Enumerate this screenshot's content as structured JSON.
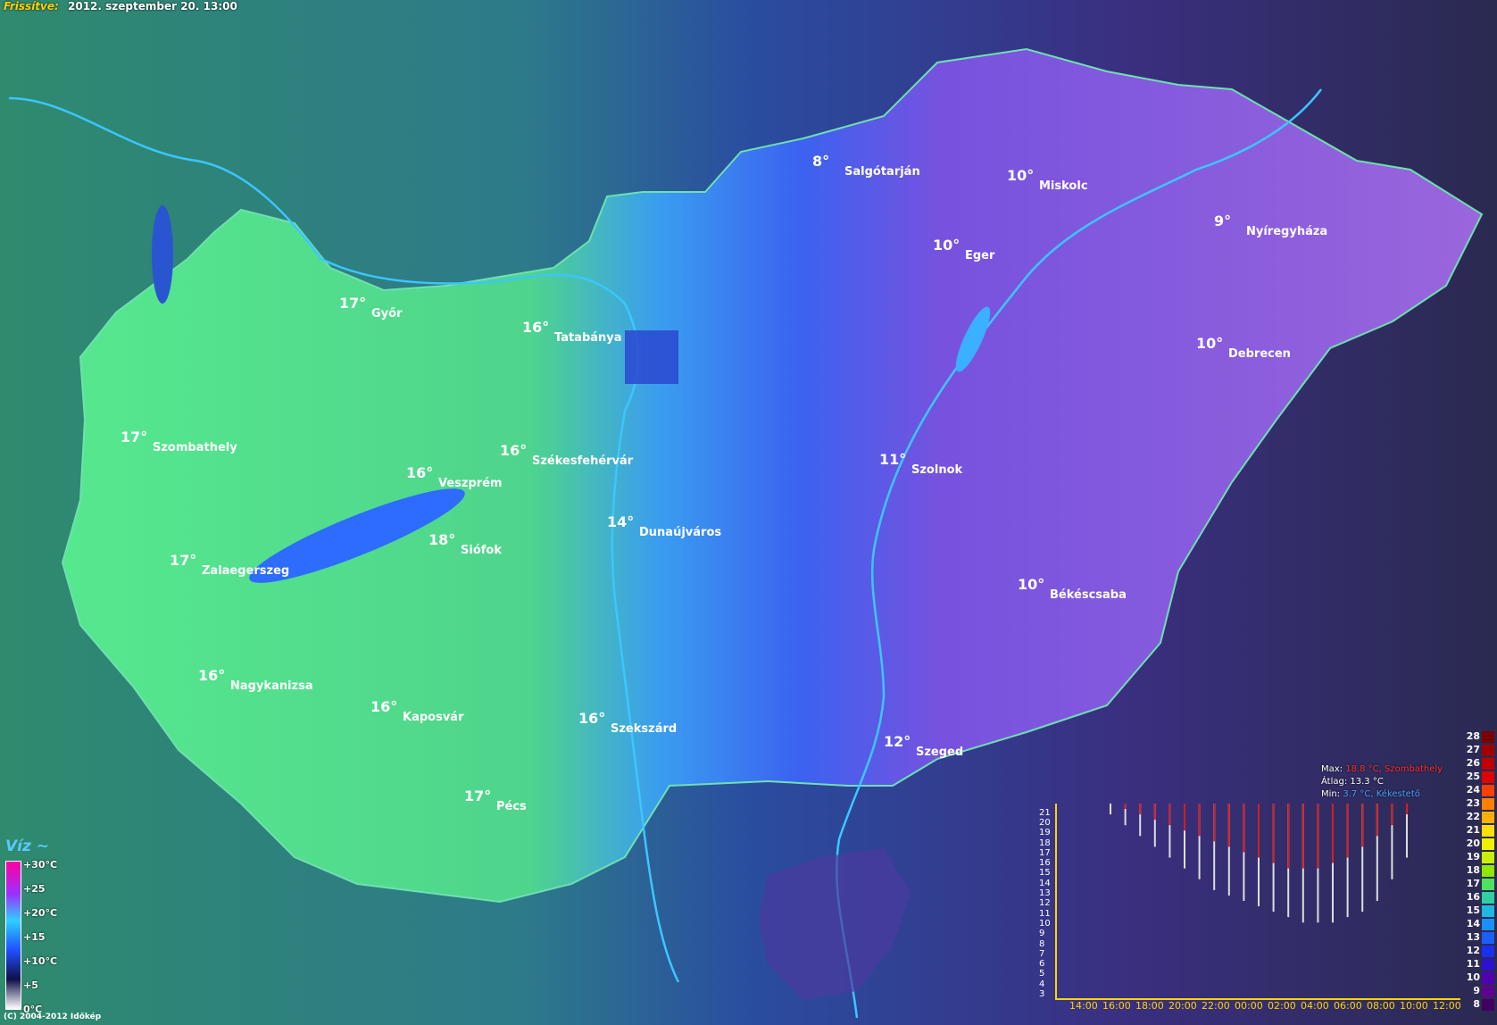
{
  "header": {
    "label": "Frissítve:",
    "timestamp": "2012. szeptember 20. 13:00"
  },
  "copyright": "(C) 2004-2012 Időkép",
  "cities": [
    {
      "name": "Győr",
      "temp": "17°"
    },
    {
      "name": "Tatabánya",
      "temp": "16°"
    },
    {
      "name": "Szombathely",
      "temp": "17°"
    },
    {
      "name": "Veszprém",
      "temp": "16°"
    },
    {
      "name": "Székesfehérvár",
      "temp": "16°"
    },
    {
      "name": "Siófok",
      "temp": "18°"
    },
    {
      "name": "Zalaegerszeg",
      "temp": "17°"
    },
    {
      "name": "Dunaújváros",
      "temp": "14°"
    },
    {
      "name": "Nagykanizsa",
      "temp": "16°"
    },
    {
      "name": "Kaposvár",
      "temp": "16°"
    },
    {
      "name": "Szekszárd",
      "temp": "16°"
    },
    {
      "name": "Pécs",
      "temp": "17°"
    },
    {
      "name": "Szeged",
      "temp": "12°"
    },
    {
      "name": "Salgótarján",
      "temp": "8°"
    },
    {
      "name": "Miskolc",
      "temp": "10°"
    },
    {
      "name": "Eger",
      "temp": "10°"
    },
    {
      "name": "Nyíregyháza",
      "temp": "9°"
    },
    {
      "name": "Debrecen",
      "temp": "10°"
    },
    {
      "name": "Szolnok",
      "temp": "11°"
    },
    {
      "name": "Békéscsaba",
      "temp": "10°"
    }
  ],
  "legend": {
    "title": "Víz ~",
    "labels": [
      "+30°C",
      "+25",
      "+20°C",
      "+15",
      "+10°C",
      "+5",
      "0°C"
    ]
  },
  "stats": {
    "max_label": "Max:",
    "max_value": "18.8 °C, Szombathely",
    "avg_label": "Átlag:",
    "avg_value": "13.3 °C",
    "min_label": "Min:",
    "min_value": "3.7 °C, Kékestető"
  },
  "temp_scale": [
    28,
    27,
    26,
    25,
    24,
    23,
    22,
    21,
    20,
    19,
    18,
    17,
    16,
    15,
    14,
    13,
    12,
    11,
    10,
    9,
    8
  ],
  "colors": {
    "green": "#4ed088",
    "blue": "#3a70ff",
    "purple": "#8a5ad8",
    "surround_teal": "#2c7a78",
    "surround_dark": "#2a3a78"
  },
  "chart_data": {
    "type": "bar",
    "x_ticks": [
      "14:00",
      "16:00",
      "18:00",
      "20:00",
      "22:00",
      "00:00",
      "02:00",
      "04:00",
      "06:00",
      "08:00",
      "10:00",
      "12:00"
    ],
    "y_ticks": [
      3,
      4,
      5,
      6,
      7,
      8,
      9,
      10,
      11,
      12,
      13,
      14,
      15,
      16,
      17,
      18,
      19,
      20,
      21
    ],
    "ylim": [
      3,
      21
    ],
    "series": [
      {
        "values": [
          20,
          19,
          18,
          17,
          16,
          15,
          14,
          13,
          12.5,
          12,
          11.5,
          11,
          10.5,
          10,
          10,
          10,
          10.5,
          11,
          12,
          14,
          16
        ]
      },
      {
        "values": [
          21,
          20.5,
          20,
          19.5,
          19,
          18.5,
          18,
          17.5,
          17,
          16.5,
          16,
          15.5,
          15,
          15,
          15,
          15.5,
          16,
          17,
          18,
          19,
          20
        ]
      }
    ]
  }
}
